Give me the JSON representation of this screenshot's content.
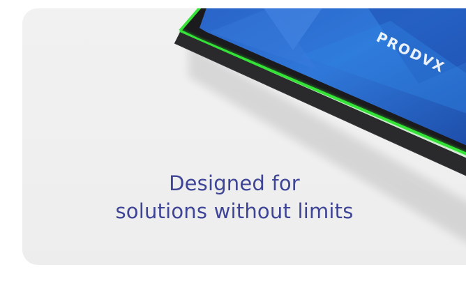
{
  "hero": {
    "brand_logo_text": "PRODVX",
    "headline_line1": "Designed for",
    "headline_line2": "solutions without limits"
  },
  "colors": {
    "headline": "#3f4596",
    "card_background": "#efefef",
    "led_bar": "#35e238",
    "screen_blue": "#2d6fd0",
    "bezel": "#1b1b1d"
  }
}
